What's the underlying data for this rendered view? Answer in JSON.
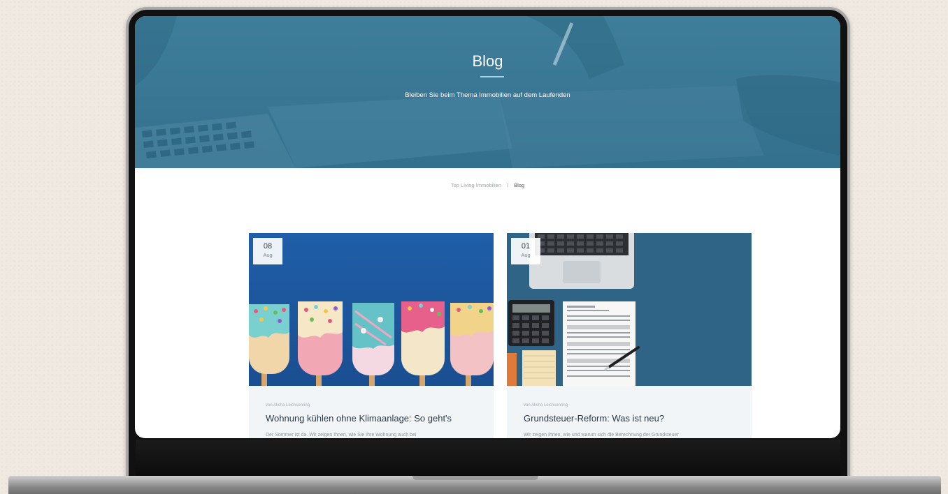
{
  "hero": {
    "title": "Blog",
    "subtitle": "Bleiben Sie beim Thema Immobilien auf dem Laufenden"
  },
  "breadcrumb": {
    "home": "Top Living Immobilien",
    "separator": "/",
    "current": "Blog"
  },
  "posts": [
    {
      "day": "08",
      "month": "Aug",
      "author": "von Alisha Leichsenring",
      "title": "Wohnung kühlen ohne Klimaanlage: So geht's",
      "excerpt": "Der Sommer ist da. Wir zeigen Ihnen, wie Sie Ihre Wohnung auch bei",
      "image_icon": "ice-cream-popsicles-image"
    },
    {
      "day": "01",
      "month": "Aug",
      "author": "von Alisha Leichsenring",
      "title": "Grundsteuer-Reform: Was ist neu?",
      "excerpt": "Wir zeigen Ihnen, wie und warum sich die Berechnung der Grundsteuer",
      "image_icon": "tax-form-desk-image"
    }
  ],
  "colors": {
    "hero": "#3a7795",
    "card_bg": "#f2f5f8",
    "accent": "#a8d3e4"
  }
}
